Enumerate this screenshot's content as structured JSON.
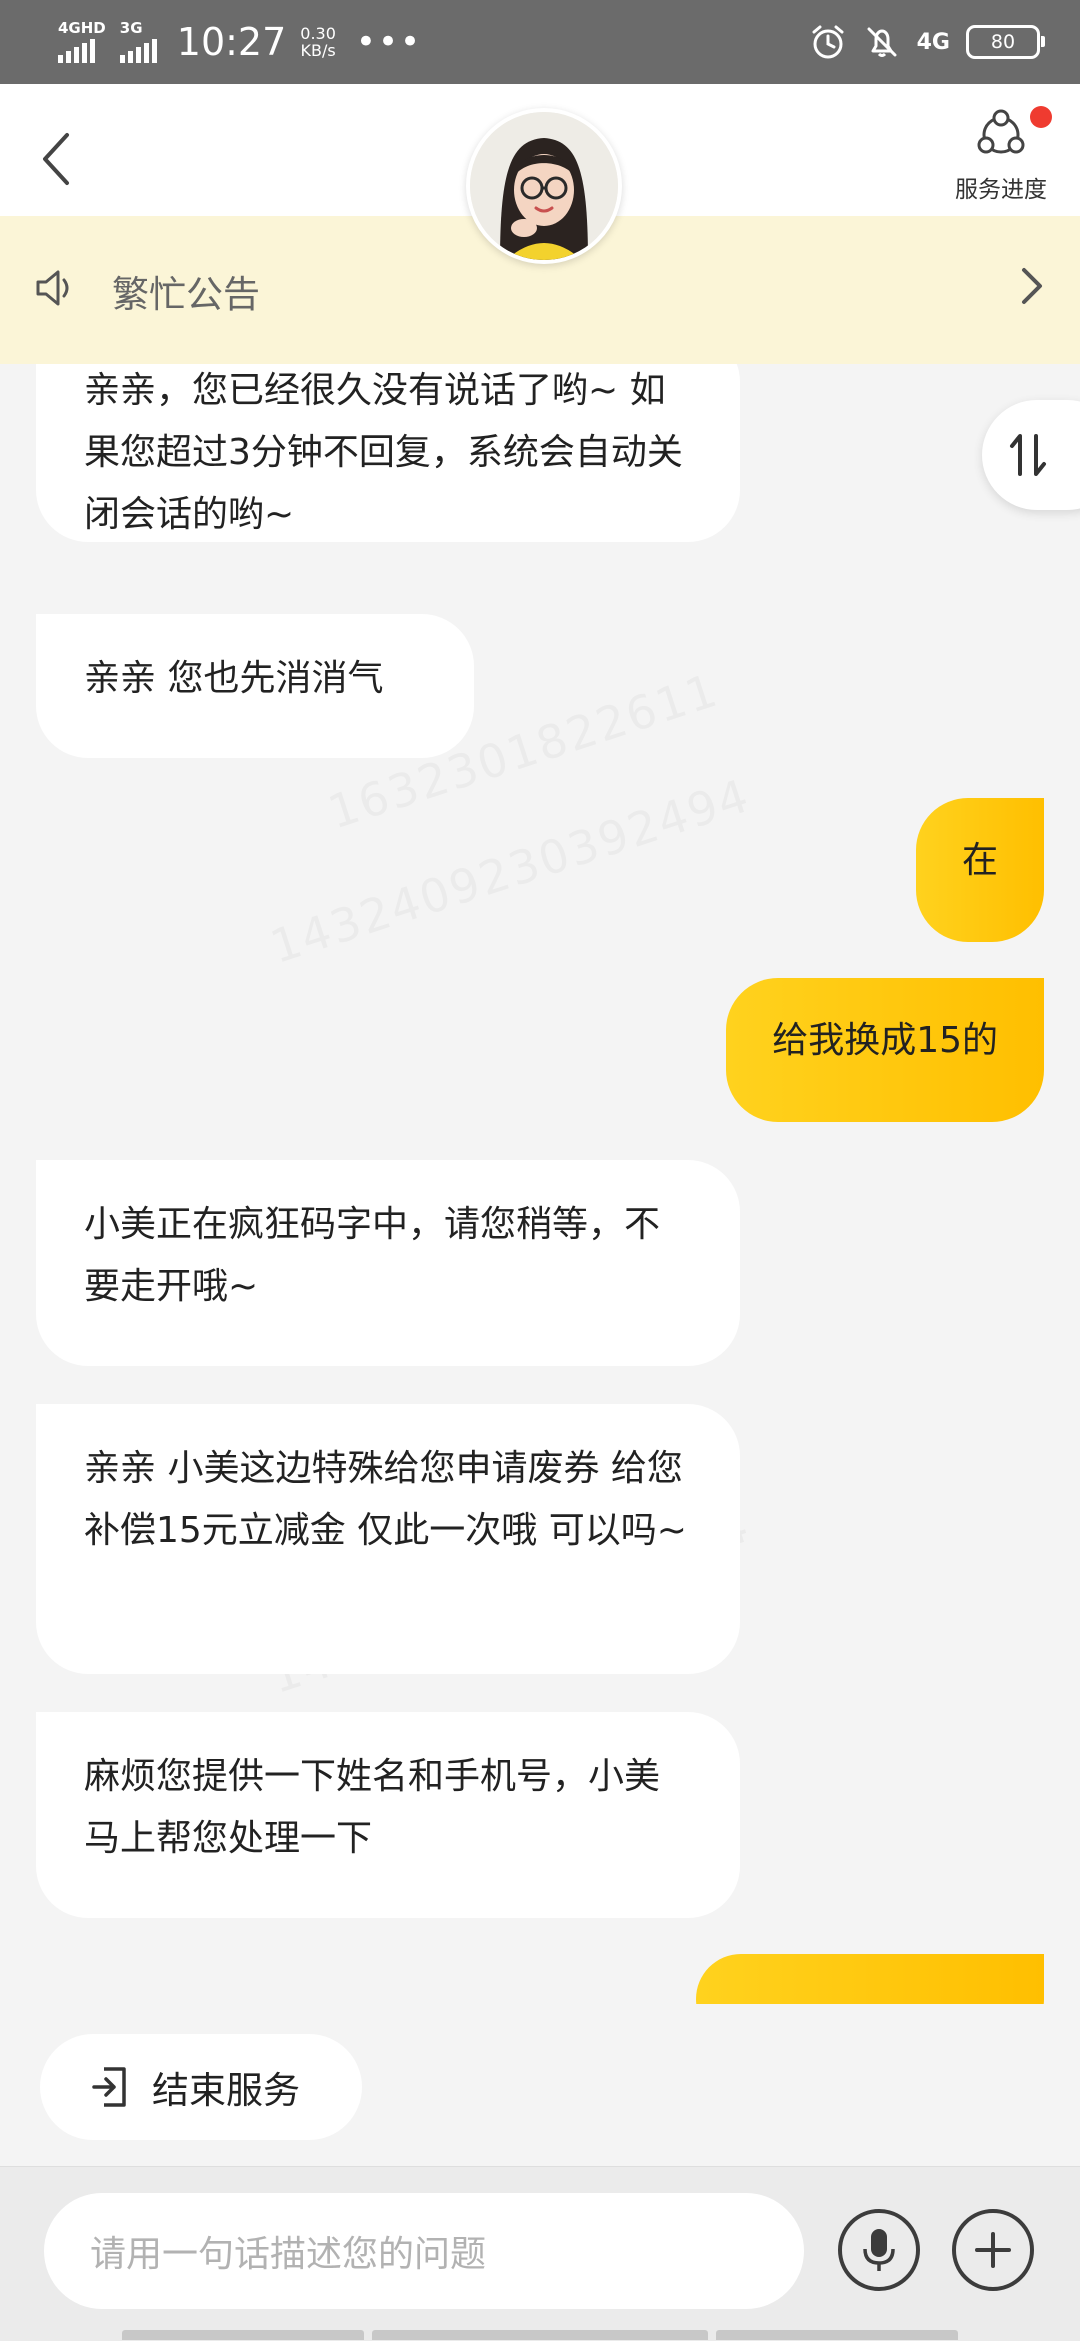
{
  "status_bar": {
    "network1": "4GHD",
    "network2": "3G",
    "time": "10:27",
    "speed_value": "0.30",
    "speed_unit": "KB/s",
    "dots": "•••",
    "right_network": "4G",
    "battery": "80"
  },
  "header": {
    "service_label": "服务进度"
  },
  "notice": {
    "text": "繁忙公告"
  },
  "messages": [
    {
      "side": "left",
      "text": "亲亲，您已经很久没有说话了哟~ 如果您超过3分钟不回复，系统会自动关闭会话的哟~"
    },
    {
      "side": "left",
      "text": "亲亲 您也先消消气"
    },
    {
      "side": "right",
      "text": "在"
    },
    {
      "side": "right",
      "text": "给我换成15的"
    },
    {
      "side": "left",
      "text": "小美正在疯狂码字中，请您稍等，不要走开哦~"
    },
    {
      "side": "left",
      "text": "亲亲 小美这边特殊给您申请废券 给您补偿15元立减金  仅此一次哦  可以吗~"
    },
    {
      "side": "left",
      "text": "麻烦您提供一下姓名和手机号，小美马上帮您处理一下"
    }
  ],
  "end_service_label": "结束服务",
  "input": {
    "placeholder": "请用一句话描述您的问题"
  },
  "colors": {
    "accent": "#ffc600",
    "notice_bg": "#fbf5d7",
    "badge": "#ef3b30"
  }
}
